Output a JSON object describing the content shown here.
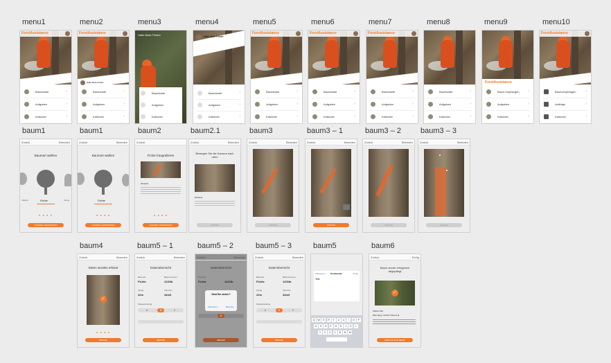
{
  "labels": {
    "row1": [
      "menu1",
      "menu2",
      "menu3",
      "menu4",
      "menu5",
      "menu6",
      "menu7",
      "menu8",
      "menu9",
      "menu10"
    ],
    "row2": [
      "baum1",
      "baum1",
      "baum2",
      "baum2.1",
      "baum3",
      "baum3 – 1",
      "baum3 – 2",
      "baum3 – 3"
    ],
    "row3": [
      "baum4",
      "baum5 – 1",
      "baum5 – 2",
      "baum5 – 3",
      "baum5",
      "baum6"
    ]
  },
  "menu": {
    "brand": "ForstAssistance",
    "items": [
      "Baumkarte",
      "Aufgaben",
      "Kalender"
    ],
    "items_menu9": [
      "Baum empfangen",
      "Aufgaben",
      "Kalender"
    ],
    "items_menu10": [
      "Baumempfangen",
      "Aufträge",
      "Kalender"
    ],
    "user": "Hallo Mark Förster"
  },
  "nav": {
    "back": "Zurück",
    "edit": "Beenden",
    "done": "Fertig"
  },
  "baum1": {
    "title": "Baumart wählen",
    "selected": "Fichte",
    "left": "Buche",
    "right": "Tanne",
    "button": "GUERRE VERWENDEN"
  },
  "baum2": {
    "title": "Fichte fotografieren",
    "hint_title": "Hinweis",
    "button": "GUERRE VERWENDEN"
  },
  "baum21": {
    "title": "Bewegen Sie die Kamera nach oben",
    "hint_title": "Hinweis"
  },
  "baum3": {
    "button": "WEITER"
  },
  "baum4": {
    "title": "Daten wurden erfasst",
    "button": "WEITER"
  },
  "baum5": {
    "title": "Datenübersicht",
    "baumart_label": "Baumart",
    "baumart": "Fichte",
    "nummer_label": "Baumnummer",
    "nummer": "12/34b",
    "laenge_label": "Länge",
    "laenge": "22m",
    "volumen_label": "Volumen",
    "volumen": "44m3",
    "klasse_label": "Klasseinteilung",
    "classes": [
      "A",
      "B",
      "C"
    ],
    "button": "WEITER"
  },
  "dialog": {
    "title": "Sind Sie sicher?",
    "cancel": "Abbrechen",
    "ok": "Beenden"
  },
  "keyboard": {
    "header_left": "Abbrechen",
    "header_mid": "Kommentar",
    "header_right": "Fertig",
    "text": "Text",
    "row1": [
      "Q",
      "W",
      "E",
      "R",
      "T",
      "Z",
      "U",
      "I",
      "O",
      "P"
    ],
    "row2": [
      "A",
      "S",
      "D",
      "F",
      "G",
      "H",
      "J",
      "K",
      "L"
    ],
    "row3": [
      "Y",
      "X",
      "C",
      "V",
      "B",
      "N",
      "M"
    ]
  },
  "baum6": {
    "title": "Baum wurde erfolgreich abgepflegt",
    "line1": "Fichte 34b",
    "line2": "22m lang / 44m3 / Klasse B",
    "button": "ZURÜCK ZUM MENÜ"
  }
}
